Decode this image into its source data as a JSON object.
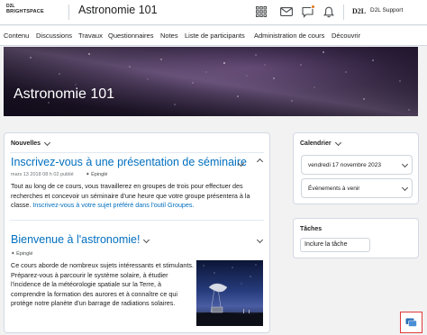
{
  "header": {
    "logo_top": "D2L",
    "logo_bottom": "BRIGHTSPACE",
    "course_title": "Astronomie 101",
    "org_mark": "D2L",
    "user_name": "D2L Support"
  },
  "nav": {
    "items": [
      "Contenu",
      "Discussions",
      "Travaux",
      "Questionnaires",
      "Notes",
      "Liste de participants",
      "Administration de cours",
      "Découvrir"
    ]
  },
  "banner": {
    "title": "Astronomie 101"
  },
  "news": {
    "heading": "Nouvelles",
    "announcements": [
      {
        "title": "Inscrivez-vous à une présentation de séminaire",
        "date": "mars 13 2018 08 h 02 publié",
        "pinned": "Épinglé",
        "body": "Tout au long de ce cours, vous travaillerez en groupes de trois pour effectuer des recherches et concevoir un séminaire d'une heure que votre groupe présentera à la classe.",
        "link": "Inscrivez-vous à votre sujet préféré dans l'outil Groupes."
      },
      {
        "title": "Bienvenue à l'astronomie!",
        "pinned": "Épinglé",
        "body": "Ce cours aborde de nombreux sujets intéressants et stimulants. Préparez-vous à parcourir le système solaire, à étudier l'incidence de la météorologie spatiale sur la Terre, à comprendre la formation des aurores et à connaître ce qui protège notre planète d'un barrage de radiations solaires."
      }
    ]
  },
  "calendar": {
    "heading": "Calendrier",
    "date_label": "vendredi 17 novembre 2023",
    "events_label": "Événements à venir"
  },
  "tasks": {
    "heading": "Tâches",
    "include_task": "Inclure la tâche"
  },
  "colors": {
    "link": "#006fbf",
    "badge": "#e87511",
    "highlight": "#e03a3a"
  }
}
